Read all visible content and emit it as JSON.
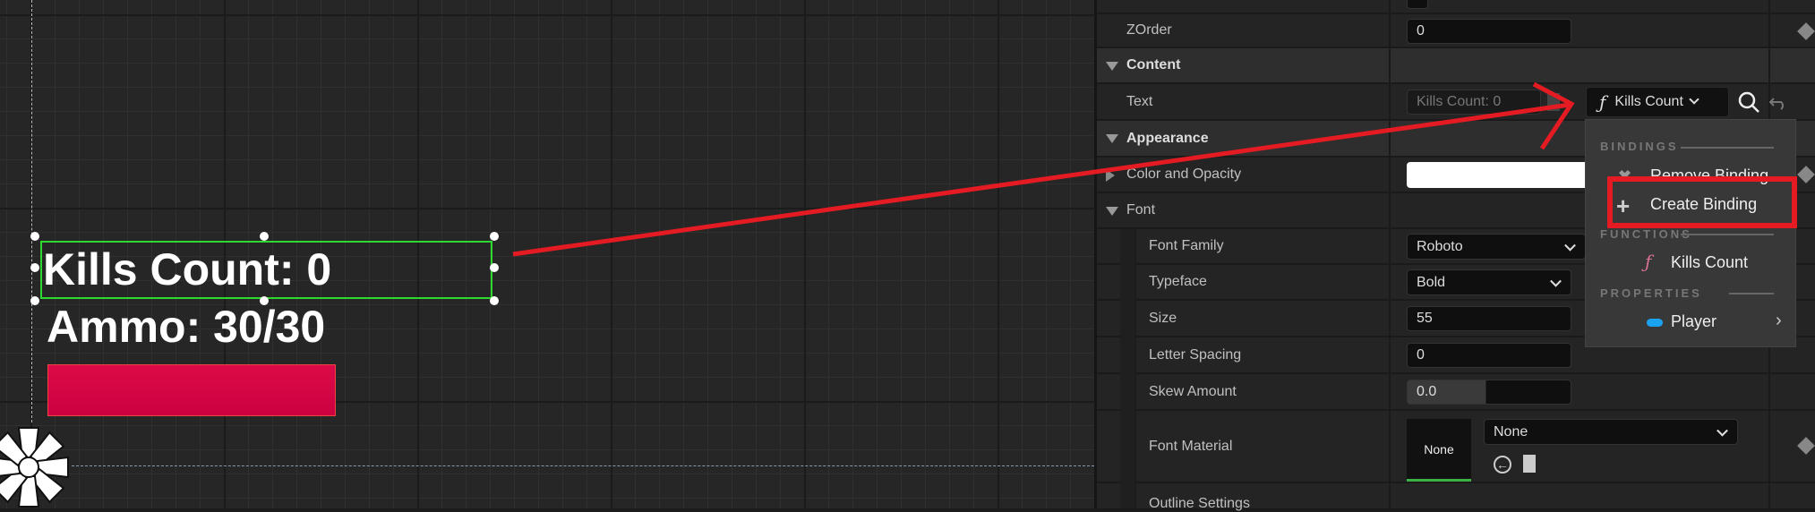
{
  "viewport": {
    "kills_text": "Kills Count: 0",
    "ammo_text": "Ammo: 30/30",
    "health_bar_color": "#d4004a",
    "selection_color": "#2fd82f"
  },
  "details": {
    "zorder": {
      "label": "ZOrder",
      "value": "0"
    },
    "content": {
      "label": "Content"
    },
    "text": {
      "label": "Text",
      "value": "Kills Count: 0",
      "binding": "Kills Count"
    },
    "appearance": {
      "label": "Appearance"
    },
    "color_opacity": {
      "label": "Color and Opacity",
      "color": "#ffffff"
    },
    "font": {
      "label": "Font"
    },
    "font_family": {
      "label": "Font Family",
      "value": "Roboto"
    },
    "typeface": {
      "label": "Typeface",
      "value": "Bold"
    },
    "size": {
      "label": "Size",
      "value": "55"
    },
    "letter_spacing": {
      "label": "Letter Spacing",
      "value": "0"
    },
    "skew": {
      "label": "Skew Amount",
      "value": "0.0"
    },
    "font_material": {
      "label": "Font Material",
      "thumb": "None",
      "value": "None"
    },
    "outline": {
      "label": "Outline Settings"
    }
  },
  "binding_menu": {
    "bindings_header": "BINDINGS",
    "remove": "Remove Binding",
    "create": "Create Binding",
    "functions_header": "FUNCTIONS",
    "function_item": "Kills Count",
    "properties_header": "PROPERTIES",
    "property_item": "Player"
  },
  "annotation_color": "#e41b23"
}
